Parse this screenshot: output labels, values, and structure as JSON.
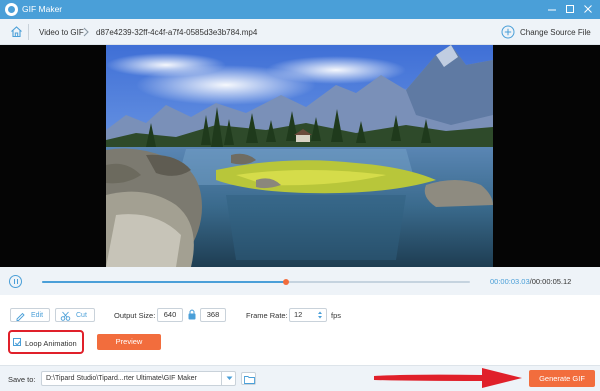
{
  "window": {
    "title": "GIF Maker"
  },
  "breadcrumb": {
    "section": "Video to GIF",
    "file": "d87e4239-32ff-4c4f-a7f4-0585d3e3b784.mp4",
    "change_source": "Change Source File"
  },
  "playback": {
    "current_time": "00:00:03.03",
    "separator": "/",
    "total_time": "00:00:05.12",
    "progress": 0.57
  },
  "controls": {
    "edit_label": "Edit",
    "cut_label": "Cut",
    "output_size_label": "Output Size:",
    "width": "640",
    "height": "368",
    "frame_rate_label": "Frame Rate:",
    "frame_rate": "12",
    "fps_label": "fps",
    "loop_label": "Loop Animation",
    "loop_checked": true,
    "preview_label": "Preview"
  },
  "bottom": {
    "save_to_label": "Save to:",
    "path": "D:\\Tipard Studio\\Tipard...rter Ultimate\\GIF Maker",
    "generate_label": "Generate GIF"
  },
  "colors": {
    "accent": "#4a9fd8",
    "orange": "#f26d3d",
    "highlight": "#e0202a"
  },
  "icons": [
    "app-icon",
    "minimize-icon",
    "maximize-icon",
    "close-icon",
    "home-icon",
    "chevron-right-icon",
    "plus-circle-icon",
    "pause-icon",
    "edit-icon",
    "scissors-icon",
    "lock-icon",
    "checkmark-icon",
    "chevron-down-icon",
    "folder-icon",
    "red-arrow-icon"
  ]
}
